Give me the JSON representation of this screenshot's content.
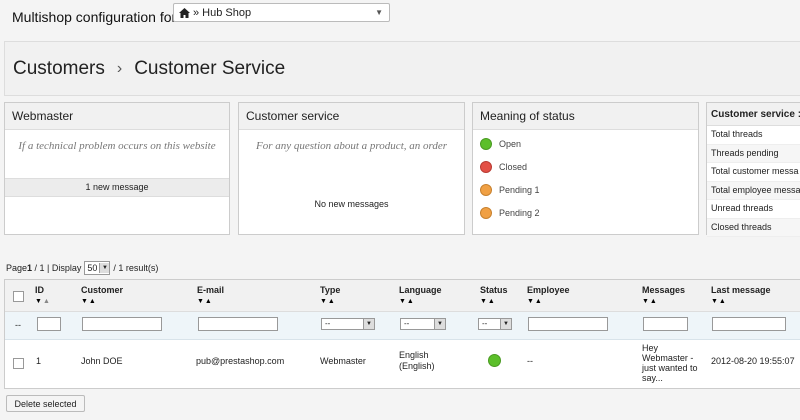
{
  "multishop": {
    "label": "Multishop configuration for",
    "shop_select_value": "» Hub Shop"
  },
  "breadcrumb": [
    "Customers",
    "›",
    "Customer Service"
  ],
  "panels": {
    "webmaster": {
      "title": "Webmaster",
      "description": "If a technical problem occurs on this website",
      "footer": "1 new message"
    },
    "customer_service": {
      "title": "Customer service",
      "description": "For any question about a product, an order",
      "footer": "No new messages"
    },
    "status_meaning": {
      "title": "Meaning of status",
      "items": [
        {
          "label": "Open",
          "color": "#5cbf2a"
        },
        {
          "label": "Closed",
          "color": "#e35046"
        },
        {
          "label": "Pending 1",
          "color": "#f0a044"
        },
        {
          "label": "Pending 2",
          "color": "#f0a044"
        }
      ]
    },
    "stats": {
      "title": "Customer service :",
      "rows": [
        "Total threads",
        "Threads pending",
        "Total customer messa",
        "Total employee messa",
        "Unread threads",
        "Closed threads"
      ]
    }
  },
  "pagination": {
    "page_prefix": "Page",
    "page_current": "1",
    "page_suffix": " / 1 | Display",
    "per_page": "50",
    "results": "/ 1 result(s)"
  },
  "table": {
    "headers": [
      "ID",
      "Customer",
      "E-mail",
      "Type",
      "Language",
      "Status",
      "Employee",
      "Messages",
      "Last message"
    ],
    "filters": {
      "leading": "--",
      "type": "--",
      "language": "--",
      "status": "--"
    },
    "rows": [
      {
        "id": "1",
        "customer": "John DOE",
        "email": "pub@prestashop.com",
        "type": "Webmaster",
        "language_line1": "English",
        "language_line2": "(English)",
        "status_color": "#5cbf2a",
        "employee": "--",
        "messages": [
          "Hey",
          "Webmaster -",
          "just wanted to",
          "say..."
        ],
        "last_message": "2012-08-20 19:55:07"
      }
    ]
  },
  "actions": {
    "delete_selected": "Delete selected"
  }
}
